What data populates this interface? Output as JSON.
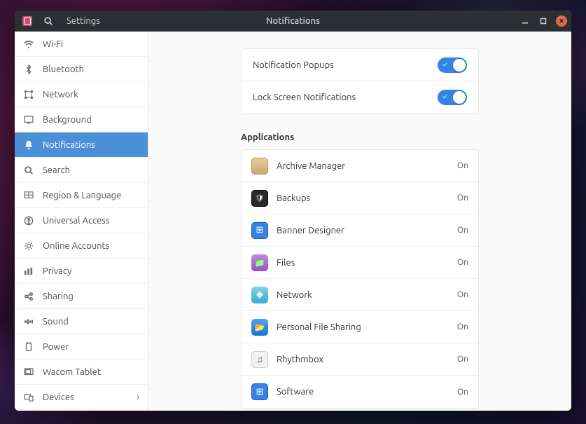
{
  "titlebar": {
    "app_label": "Settings",
    "page_title": "Notifications"
  },
  "sidebar": {
    "items": [
      {
        "icon": "wifi",
        "label": "Wi-Fi"
      },
      {
        "icon": "bluetooth",
        "label": "Bluetooth"
      },
      {
        "icon": "network",
        "label": "Network"
      },
      {
        "icon": "background",
        "label": "Background"
      },
      {
        "icon": "bell",
        "label": "Notifications",
        "selected": true
      },
      {
        "icon": "search",
        "label": "Search"
      },
      {
        "icon": "region",
        "label": "Region & Language"
      },
      {
        "icon": "access",
        "label": "Universal Access"
      },
      {
        "icon": "online",
        "label": "Online Accounts"
      },
      {
        "icon": "privacy",
        "label": "Privacy"
      },
      {
        "icon": "sharing",
        "label": "Sharing"
      },
      {
        "icon": "sound",
        "label": "Sound"
      },
      {
        "icon": "power",
        "label": "Power"
      },
      {
        "icon": "wacom",
        "label": "Wacom Tablet"
      },
      {
        "icon": "devices",
        "label": "Devices",
        "has_children": true
      }
    ]
  },
  "toggles": [
    {
      "label": "Notification Popups",
      "value": true
    },
    {
      "label": "Lock Screen Notifications",
      "value": true
    }
  ],
  "apps_section_title": "Applications",
  "apps": [
    {
      "name": "Archive Manager",
      "state": "On",
      "icon": "ic-archive"
    },
    {
      "name": "Backups",
      "state": "On",
      "icon": "ic-backups"
    },
    {
      "name": "Banner Designer",
      "state": "On",
      "icon": "ic-banner"
    },
    {
      "name": "Files",
      "state": "On",
      "icon": "ic-files"
    },
    {
      "name": "Network",
      "state": "On",
      "icon": "ic-network"
    },
    {
      "name": "Personal File Sharing",
      "state": "On",
      "icon": "ic-personal"
    },
    {
      "name": "Rhythmbox",
      "state": "On",
      "icon": "ic-rhythm"
    },
    {
      "name": "Software",
      "state": "On",
      "icon": "ic-software"
    }
  ]
}
